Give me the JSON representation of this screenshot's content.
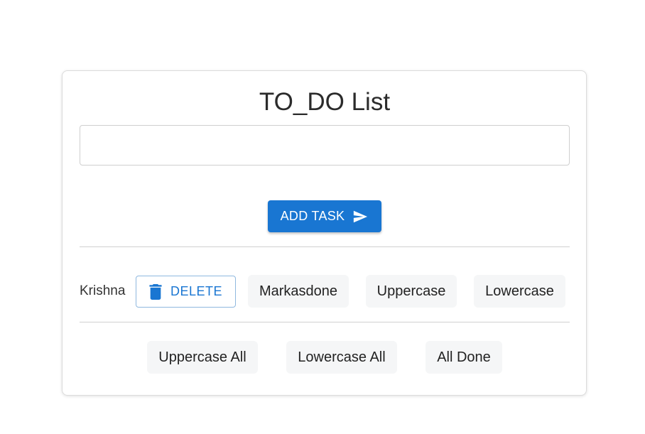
{
  "title": "TO_DO List",
  "input": {
    "value": "",
    "placeholder": ""
  },
  "add_button": {
    "label": "ADD TASK",
    "icon": "send-icon"
  },
  "tasks": [
    {
      "label": "Krishna",
      "delete_label": "DELETE",
      "delete_icon": "trash-icon",
      "mark_done_label": "Markasdone",
      "uppercase_label": "Uppercase",
      "lowercase_label": "Lowercase"
    }
  ],
  "bulk_actions": {
    "uppercase_all": "Uppercase All",
    "lowercase_all": "Lowercase All",
    "all_done": "All Done"
  },
  "colors": {
    "primary": "#1976d2",
    "secondary_button_bg": "#f5f6f7",
    "divider": "#d0d0d0"
  }
}
